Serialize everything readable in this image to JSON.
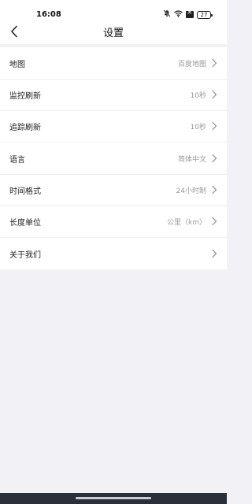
{
  "status_bar": {
    "time": "16:08",
    "battery": "27",
    "icons": [
      "mute-bell-icon",
      "wifi-icon",
      "box-x-icon",
      "battery-icon"
    ]
  },
  "nav": {
    "title": "设置",
    "back_icon": "chevron-left-icon"
  },
  "groups": [
    {
      "items": [
        {
          "label": "地图",
          "value": "百度地图"
        },
        {
          "label": "监控刷新",
          "value": "10秒"
        },
        {
          "label": "追踪刷新",
          "value": "10秒"
        }
      ]
    },
    {
      "items": [
        {
          "label": "语言",
          "value": "简体中文"
        },
        {
          "label": "时间格式",
          "value": "24小时制"
        },
        {
          "label": "长度单位",
          "value": "公里（km）"
        }
      ]
    },
    {
      "items": [
        {
          "label": "关于我们",
          "value": ""
        }
      ]
    }
  ],
  "colors": {
    "background": "#f2f2f6",
    "row_background": "#ffffff",
    "value_text": "#999999",
    "gesture_bar": "#2b2f3a"
  }
}
